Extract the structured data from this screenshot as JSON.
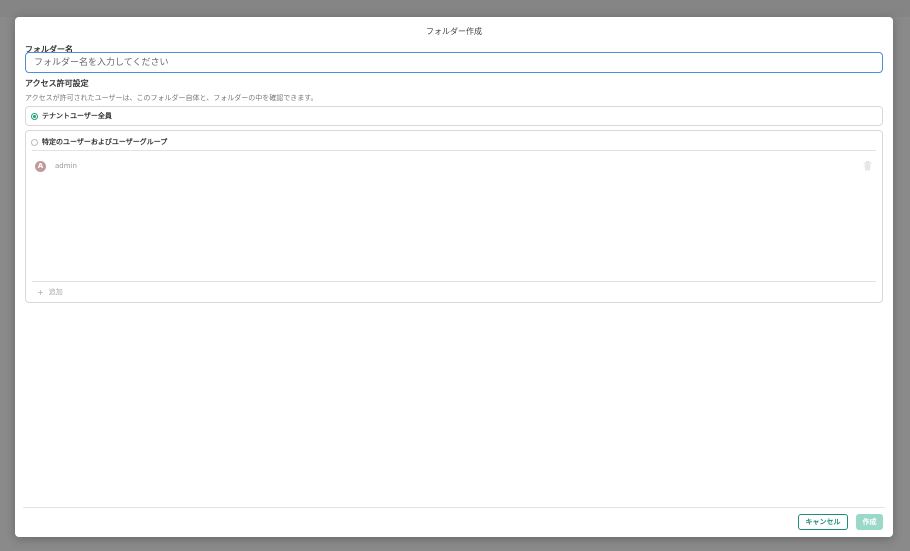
{
  "modal": {
    "title": "フォルダー作成",
    "folder_name_label": "フォルダー名",
    "folder_name_value": "",
    "folder_name_placeholder": "フォルダー名を入力してください",
    "access_label": "アクセス許可設定",
    "access_description": "アクセスが許可されたユーザーは、このフォルダー自体と、フォルダーの中を確認できます。",
    "options": [
      {
        "label": "テナントユーザー全員",
        "selected": true
      },
      {
        "label": "特定のユーザーおよびユーザーグループ",
        "selected": false
      }
    ],
    "users": [
      {
        "initial": "A",
        "name": "admin"
      }
    ],
    "add_label": "追加",
    "cancel_label": "キャンセル",
    "create_label": "作成"
  },
  "colors": {
    "accent": "#1e8c77",
    "radio_selected": "#1ea380",
    "input_focus": "#4a90d9",
    "create_disabled": "#9ad9c8",
    "avatar": "#c29a9a",
    "overlay": "#8a8a8a"
  },
  "icons": {
    "radio_selected": "radio-on-icon",
    "radio_unselected": "radio-off-icon",
    "trash": "trash-icon",
    "plus": "plus-icon"
  }
}
